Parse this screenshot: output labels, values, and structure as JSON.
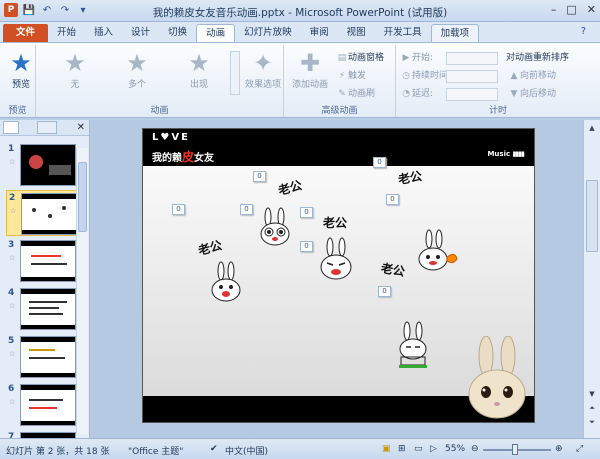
{
  "window": {
    "title": "我的赖皮女友音乐动画.pptx - Microsoft PowerPoint (试用版)",
    "controls": {
      "minimize": "–",
      "maximize": "□",
      "close": "✕"
    }
  },
  "quick_access": {
    "save": "💾",
    "undo": "↶",
    "redo": "↷",
    "customize": "▾"
  },
  "tabs": [
    {
      "label": "文件"
    },
    {
      "label": "开始"
    },
    {
      "label": "插入"
    },
    {
      "label": "设计"
    },
    {
      "label": "切换"
    },
    {
      "label": "动画"
    },
    {
      "label": "幻灯片放映"
    },
    {
      "label": "审阅"
    },
    {
      "label": "视图"
    },
    {
      "label": "开发工具"
    },
    {
      "label": "加载项"
    }
  ],
  "ribbon": {
    "preview": {
      "button": "预览",
      "group": "预览"
    },
    "animation": {
      "group": "动画",
      "effects": [
        {
          "label": "无"
        },
        {
          "label": "多个"
        },
        {
          "label": "出现"
        }
      ],
      "effect_options": "效果选项"
    },
    "advanced": {
      "group": "高级动画",
      "add_animation": "添加动画",
      "animation_pane": "动画窗格",
      "trigger": "触发",
      "animation_painter": "动画刷"
    },
    "timing": {
      "group": "计时",
      "start": "开始:",
      "duration": "持续时间:",
      "delay": "延迟:",
      "reorder_title": "对动画重新排序",
      "move_earlier": "向前移动",
      "move_later": "向后移动"
    }
  },
  "slides_panel": {
    "slides": [
      {
        "num": "1"
      },
      {
        "num": "2"
      },
      {
        "num": "3"
      },
      {
        "num": "4"
      },
      {
        "num": "5"
      },
      {
        "num": "6"
      },
      {
        "num": "7"
      }
    ],
    "star_marker": "☆"
  },
  "slide": {
    "love": "L♥VE",
    "title_pre": "我的赖",
    "title_red": "皮",
    "title_post": "女友",
    "music": "Music",
    "laogong": "老公",
    "tag_value": "0"
  },
  "status": {
    "slide_info": "幻灯片 第 2 张，共 18 张",
    "theme": "\"Office 主题\"",
    "language": "中文(中国)",
    "zoom": "55%"
  }
}
